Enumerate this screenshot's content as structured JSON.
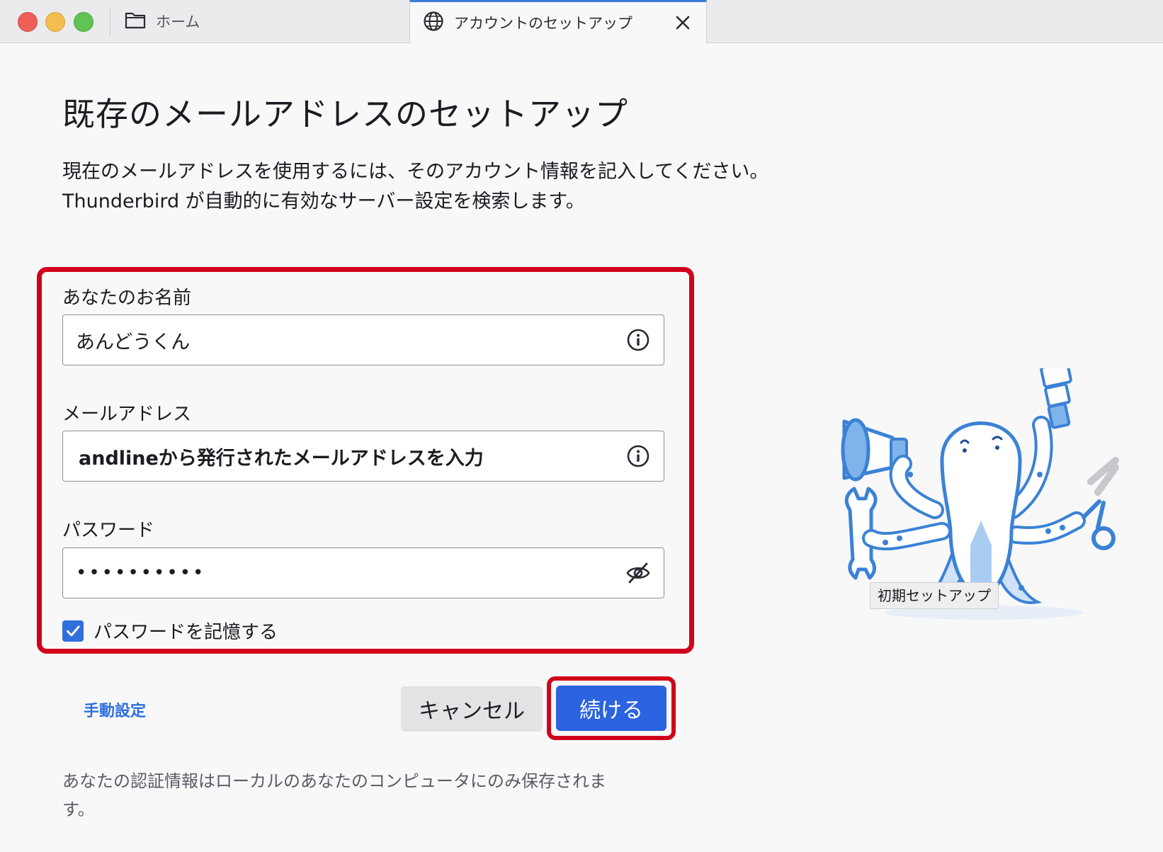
{
  "tabs": {
    "home_label": "ホーム",
    "active_label": "アカウントのセットアップ"
  },
  "page": {
    "title": "既存のメールアドレスのセットアップ",
    "description_line1": "現在のメールアドレスを使用するには、そのアカウント情報を記入してください。",
    "description_line2": "Thunderbird が自動的に有効なサーバー設定を検索します。"
  },
  "form": {
    "name_label": "あなたのお名前",
    "name_value": "あんどうくん",
    "email_label": "メールアドレス",
    "email_value": "andlineから発行されたメールアドレスを入力",
    "password_label": "パスワード",
    "password_value": "••••••••••",
    "remember_label": "パスワードを記憶する",
    "remember_checked": true
  },
  "actions": {
    "manual_label": "手動設定",
    "cancel_label": "キャンセル",
    "continue_label": "続ける"
  },
  "footnote": {
    "line1": "あなたの認証情報はローカルのあなたのコンピュータにのみ保存されま",
    "line2": "す。"
  },
  "illustration": {
    "caption": "初期セットアップ"
  },
  "colors": {
    "accent": "#2b63e0",
    "highlight": "#d0021b",
    "link": "#2f6fde"
  }
}
